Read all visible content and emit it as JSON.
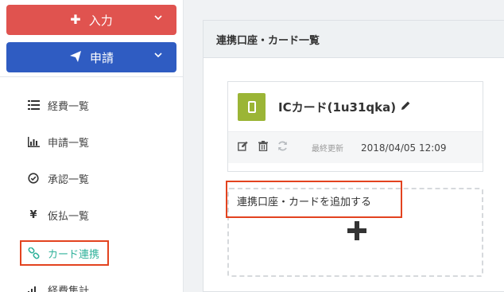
{
  "sidebar": {
    "buttons": [
      {
        "icon": "plus-icon",
        "label": "入力",
        "color": "#e0534f"
      },
      {
        "icon": "paper-plane-icon",
        "label": "申請",
        "color": "#2f5cc2"
      }
    ],
    "items": [
      {
        "icon": "list-icon",
        "label": "経費一覧"
      },
      {
        "icon": "bar-chart-icon",
        "label": "申請一覧"
      },
      {
        "icon": "check-circle-icon",
        "label": "承認一覧"
      },
      {
        "icon": "yen-icon",
        "symbol": "¥",
        "label": "仮払一覧"
      },
      {
        "icon": "link-icon",
        "label": "カード連携",
        "active": true
      },
      {
        "icon": "signal-icon",
        "label": "経費集計"
      }
    ],
    "active_color": "#31b29b"
  },
  "panel": {
    "title": "連携口座・カード一覧",
    "card": {
      "name": "ICカード(1u31qka)",
      "icon_color": "#9bb536",
      "last_updated_label": "最終更新",
      "last_updated_value": "2018/04/05 12:09"
    },
    "add_label": "連携口座・カードを追加する"
  },
  "highlight_color": "#e3431f"
}
